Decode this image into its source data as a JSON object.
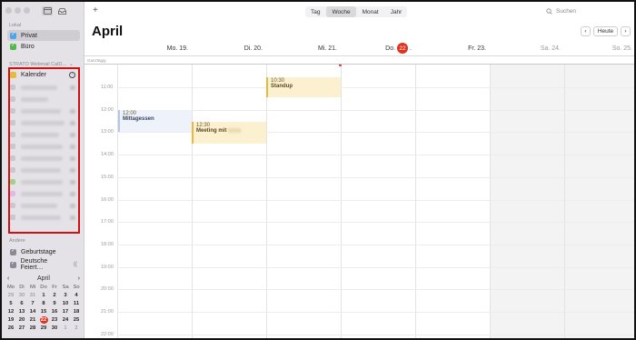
{
  "sidebar": {
    "sections": {
      "local": "Lokal",
      "strato": "STRATO Webmail CalD…",
      "other": "Andere"
    },
    "local_calendars": [
      {
        "label": "Privat",
        "color": "#4ea4e8",
        "checked": true,
        "selected": true
      },
      {
        "label": "Büro",
        "color": "#4fb84f",
        "checked": true,
        "selected": false
      }
    ],
    "strato_calendars": [
      {
        "label": "Kalender",
        "color": "#e7b93c",
        "checked": false
      }
    ],
    "other_calendars": [
      {
        "label": "Geburtstage",
        "color": "#8a8a96",
        "checked": true
      },
      {
        "label": "Deutsche Feiert…",
        "color": "#8a8a96",
        "checked": true
      }
    ],
    "mini_calendar": {
      "month": "April",
      "weekdays": [
        "Mo",
        "Di",
        "Mi",
        "Do",
        "Fr",
        "Sa",
        "So"
      ],
      "weeks": [
        [
          "29",
          "30",
          "31",
          "1",
          "2",
          "3",
          "4"
        ],
        [
          "5",
          "6",
          "7",
          "8",
          "9",
          "10",
          "11"
        ],
        [
          "12",
          "13",
          "14",
          "15",
          "16",
          "17",
          "18"
        ],
        [
          "19",
          "20",
          "21",
          "22",
          "23",
          "24",
          "25"
        ],
        [
          "26",
          "27",
          "28",
          "29",
          "30",
          "1",
          "2"
        ]
      ],
      "today": "22"
    }
  },
  "toolbar": {
    "add_label": "+",
    "views": [
      "Tag",
      "Woche",
      "Monat",
      "Jahr"
    ],
    "active_view": "Woche",
    "search_placeholder": "Suchen"
  },
  "header": {
    "month": "April",
    "today_button": "Heute"
  },
  "week": {
    "days": [
      {
        "label": "Mo. 19."
      },
      {
        "label": "Di. 20."
      },
      {
        "label": "Mi. 21."
      },
      {
        "label": "Do.",
        "num": "22",
        "suffix": "."
      },
      {
        "label": "Fr. 23."
      },
      {
        "label": "Sa. 24."
      },
      {
        "label": "So. 25."
      }
    ],
    "allday_label": "Ganztägig",
    "hours": [
      "11:00",
      "12:00",
      "13:00",
      "14:00",
      "15:00",
      "16:00",
      "17:00",
      "18:00",
      "19:00",
      "20:00",
      "21:00",
      "22:00"
    ]
  },
  "events": [
    {
      "time": "10:30",
      "title": "Standup",
      "color": "#e8b93a"
    },
    {
      "time": "12:00",
      "title": "Mittagessen",
      "color": "#b6c6e6"
    },
    {
      "time": "12:30",
      "title": "Meeting mit",
      "color": "#e8b93a"
    }
  ]
}
